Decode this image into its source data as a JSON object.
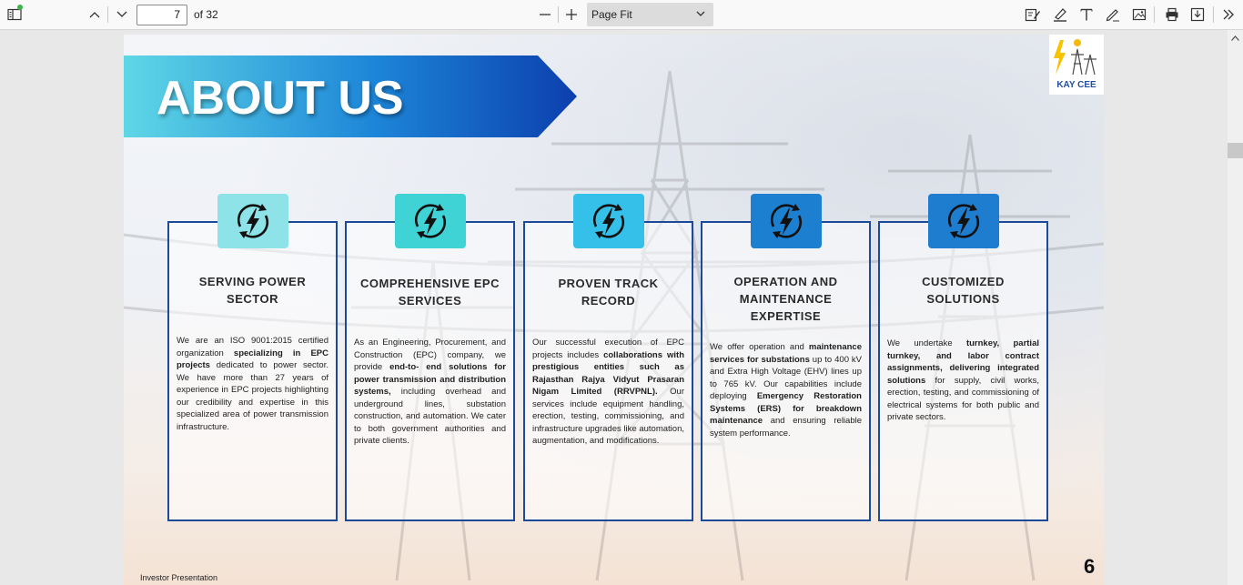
{
  "toolbar": {
    "current_page": "7",
    "page_of": "of 32",
    "zoom": "Page Fit"
  },
  "slide": {
    "title": "ABOUT US",
    "logo_text": "KAY CEE",
    "footer": "Investor Presentation",
    "page_number": "6",
    "cards": [
      {
        "title_lines": [
          "SERVING POWER",
          "SECTOR"
        ],
        "icon_color": "#8ee3e8",
        "body_html": "We are an ISO 9001:2015 certified organization <b>specializing in EPC projects</b> dedicated to power sector. We have more than 27 years of experience in EPC projects highlighting our credibility and expertise in this specialized area of power transmission infrastructure."
      },
      {
        "title_lines": [
          "COMPREHENSIVE EPC",
          "SERVICES"
        ],
        "icon_color": "#3fd3d6",
        "body_html": "As an Engineering, Procurement, and Construction (EPC) company, we provide <b>end-to- end solutions for power transmission and distribution systems,</b> including overhead and underground lines, substation construction, and automation. We cater to both government authorities and private clients."
      },
      {
        "title_lines": [
          "PROVEN TRACK",
          "RECORD"
        ],
        "icon_color": "#35c0ea",
        "body_html": "Our successful execution of EPC projects includes <b>collaborations with prestigious entities such as Rajasthan Rajya Vidyut Prasaran Nigam Limited (RRVPNL).</b> Our services include equipment handling, erection, testing, commissioning, and infrastructure upgrades like automation, augmentation, and modifications."
      },
      {
        "title_lines": [
          "OPERATION AND",
          "MAINTENANCE",
          "EXPERTISE"
        ],
        "icon_color": "#1d7fd0",
        "body_html": "We offer operation and <b>maintenance services for substations</b> up to 400 kV and Extra High Voltage (EHV) lines up to 765 kV. Our capabilities include deploying <b>Emergency Restoration Systems (ERS) for breakdown maintenance</b> and ensuring reliable system performance."
      },
      {
        "title_lines": [
          "CUSTOMIZED",
          "SOLUTIONS"
        ],
        "icon_color": "#1f7dd0",
        "body_html": "We undertake <b>turnkey, partial turnkey, and labor contract assignments, delivering integrated solutions</b> for supply, civil works, erection, testing, and commissioning of electrical systems for both public and private sectors."
      }
    ]
  }
}
